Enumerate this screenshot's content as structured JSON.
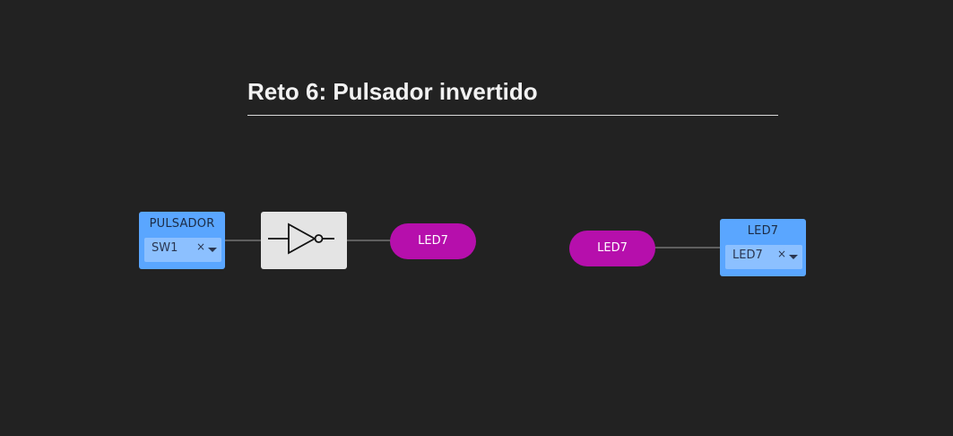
{
  "page": {
    "title": "Reto 6: Pulsador invertido"
  },
  "colors": {
    "background": "#222222",
    "input_block": "#5aa6ff",
    "input_select": "#8cc0ff",
    "gate": "#e4e4e4",
    "led": "#b60fac",
    "wire": "#5f5f5f"
  },
  "circuit_1": {
    "input": {
      "label": "PULSADOR",
      "value": "SW1",
      "clear": "×"
    },
    "gate_icon": "not-gate-icon",
    "output": {
      "label": "LED7"
    }
  },
  "circuit_2": {
    "source": {
      "label": "LED7"
    },
    "output_block": {
      "label": "LED7",
      "value": "LED7",
      "clear": "×"
    }
  }
}
